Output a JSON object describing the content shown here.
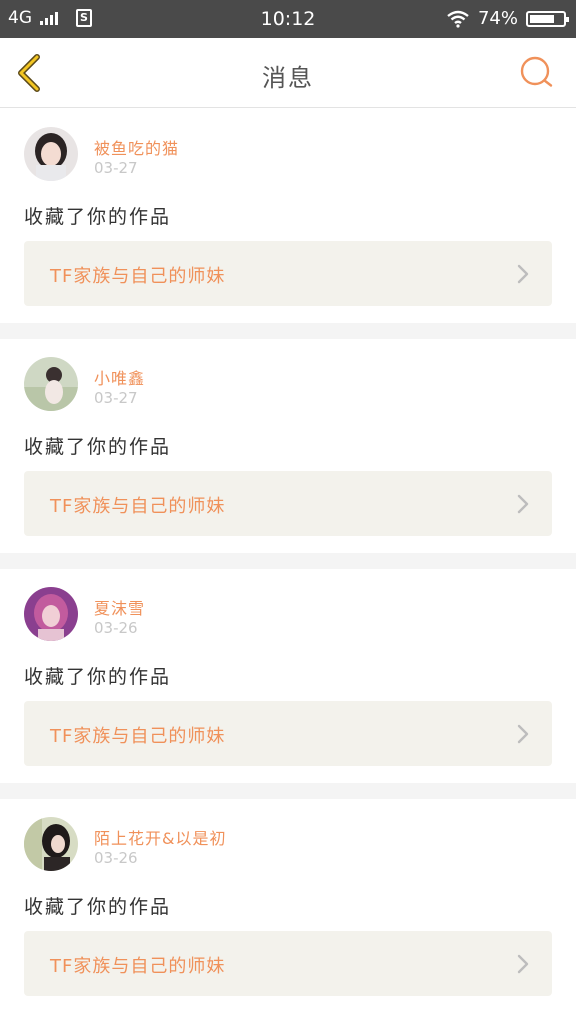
{
  "status_bar": {
    "network": "4G",
    "time": "10:12",
    "battery": "74%",
    "battery_level": 0.74,
    "icons": [
      "signal-icon",
      "sim-icon",
      "wifi-icon",
      "battery-icon"
    ]
  },
  "header": {
    "title": "消息",
    "back_icon": "chevron-left-icon",
    "search_icon": "search-icon",
    "accent_color": "#f0915a",
    "back_color": "#e6b800"
  },
  "messages": [
    {
      "username": "被鱼吃的猫",
      "date": "03-27",
      "action": "收藏了你的作品",
      "work_title": "TF家族与自己的师妹"
    },
    {
      "username": "小唯鑫",
      "date": "03-27",
      "action": "收藏了你的作品",
      "work_title": "TF家族与自己的师妹"
    },
    {
      "username": "夏沫雪",
      "date": "03-26",
      "action": "收藏了你的作品",
      "work_title": "TF家族与自己的师妹"
    },
    {
      "username": "陌上花开&以是初",
      "date": "03-26",
      "action": "收藏了你的作品",
      "work_title": "TF家族与自己的师妹"
    }
  ]
}
